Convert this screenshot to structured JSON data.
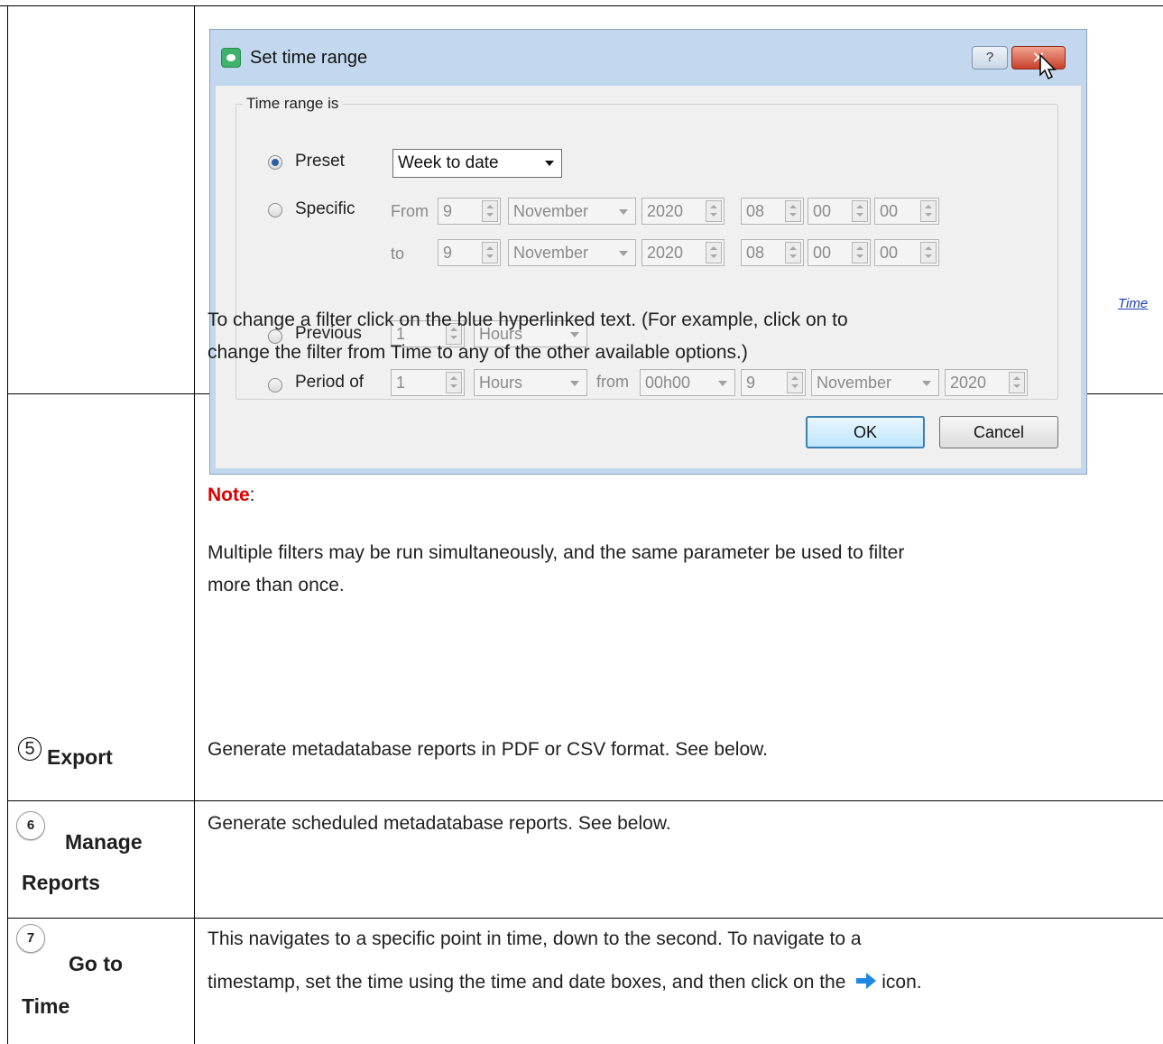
{
  "dialog": {
    "title": "Set time range",
    "help_label": "?",
    "close_label": "✕",
    "group_label": "Time range is",
    "preset": {
      "label": "Preset",
      "value": "Week to date",
      "selected": true
    },
    "specific": {
      "label": "Specific",
      "from_label": "From",
      "to_label": "to",
      "from": {
        "day": "9",
        "month": "November",
        "year": "2020",
        "hour": "08",
        "minute": "00",
        "second": "00"
      },
      "to": {
        "day": "9",
        "month": "November",
        "year": "2020",
        "hour": "08",
        "minute": "00",
        "second": "00"
      }
    },
    "previous": {
      "label": "Previous",
      "count": "1",
      "unit": "Hours"
    },
    "period_of": {
      "label": "Period of",
      "count": "1",
      "unit": "Hours",
      "from_label": "from",
      "time": "00h00",
      "day": "9",
      "month": "November",
      "year": "2020"
    },
    "ok_label": "OK",
    "cancel_label": "Cancel"
  },
  "note": {
    "heading": "Note",
    "colon": ":",
    "para1_line1": "Multiple filters may be run simultaneously, and the same parameter be used to filter",
    "para1_line2": "more than once.",
    "para2_line1": "To change a filter click on the blue hyperlinked text. (For example, click on to",
    "para2_line2": "change the filter from Time to any of the other available options.)",
    "time_link": "Time"
  },
  "rows": [
    {
      "num": "5",
      "title_line1": "Export",
      "title_line2": "",
      "desc_line1": "Generate metadatabase reports in PDF or CSV format. See below.",
      "desc_line2": ""
    },
    {
      "num": "6",
      "title_line1": "Manage",
      "title_line2": "Reports",
      "desc_line1": "Generate scheduled metadatabase reports. See below.",
      "desc_line2": ""
    },
    {
      "num": "7",
      "title_line1": "Go to",
      "title_line2": "Time",
      "desc_line1": "This navigates to a specific point in time, down to the second. To navigate to a",
      "desc_line2_a": "timestamp, set the time using the time and date boxes, and then click on the",
      "desc_line2_b": "icon."
    }
  ],
  "colors": {
    "note": "#e00000",
    "link": "#1a3fb0",
    "arrow_icon": "#1e88e5"
  }
}
